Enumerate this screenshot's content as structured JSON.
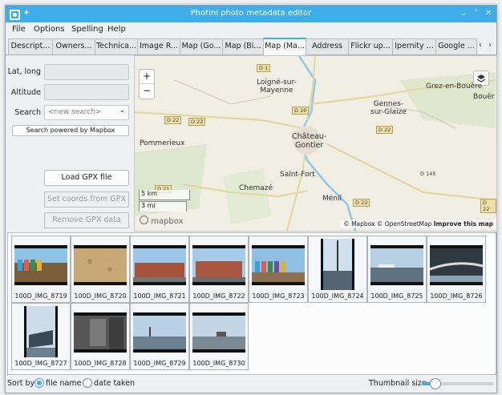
{
  "window": {
    "title": "Photini photo metadata editor"
  },
  "menu": {
    "items": [
      "File",
      "Options",
      "Spelling",
      "Help"
    ]
  },
  "tabs": [
    {
      "label": "Descript..."
    },
    {
      "label": "Owners..."
    },
    {
      "label": "Technica..."
    },
    {
      "label": "Image R..."
    },
    {
      "label": "Map (Go..."
    },
    {
      "label": "Map (Bi..."
    },
    {
      "label": "Map (Ma..."
    },
    {
      "label": "Address"
    },
    {
      "label": "Flickr up..."
    },
    {
      "label": "Ipernity ..."
    },
    {
      "label": "Google ..."
    }
  ],
  "left": {
    "latlong_label": "Lat, long",
    "altitude_label": "Altitude",
    "search_label": "Search",
    "search_placeholder": "<new search>",
    "search_powered": "Search powered by Mapbox",
    "load_gpx": "Load GPX file",
    "set_coords": "Set coords from GPX",
    "remove_gpx": "Remove GPX data"
  },
  "map": {
    "zoom_in": "+",
    "zoom_out": "−",
    "places": {
      "loigne": "Loigné-sur-\nMayenne",
      "gennes": "Gennes-\nsur-Glaize",
      "grez": "Grez-en-Bouère",
      "bouere": "Bouèr",
      "pommerieux": "Pommerieux",
      "chateau": "Château-\nGontier",
      "saintfort": "Saint-Fort",
      "chemaze": "Chemazé",
      "menil": "Ménil"
    },
    "roads": {
      "d1": "D 1",
      "d20": "D 20",
      "d22a": "D 22",
      "d22b": "D 22",
      "d22c": "D 22",
      "d21": "D 21",
      "d145": "D 145",
      "d22d": "D 22",
      "d22e": "D 22"
    },
    "scale_km": "5 km",
    "scale_mi": "3 mi",
    "logo": "mapbox",
    "attribution": "© Mapbox © OpenStreetMap",
    "improve": "Improve this map"
  },
  "thumbnails": [
    {
      "name": "100D_IMG_8719"
    },
    {
      "name": "100D_IMG_8720"
    },
    {
      "name": "100D_IMG_8721"
    },
    {
      "name": "100D_IMG_8722"
    },
    {
      "name": "100D_IMG_8723"
    },
    {
      "name": "100D_IMG_8724"
    },
    {
      "name": "100D_IMG_8725"
    },
    {
      "name": "100D_IMG_8726"
    },
    {
      "name": "100D_IMG_8727"
    },
    {
      "name": "100D_IMG_8728"
    },
    {
      "name": "100D_IMG_8729"
    },
    {
      "name": "100D_IMG_8730"
    }
  ],
  "bottom": {
    "sort_by": "Sort by",
    "file_name": "file name",
    "date_taken": "date taken",
    "thumbnail_size": "Thumbnail size"
  },
  "colors": {
    "accent": "#3daee9"
  }
}
